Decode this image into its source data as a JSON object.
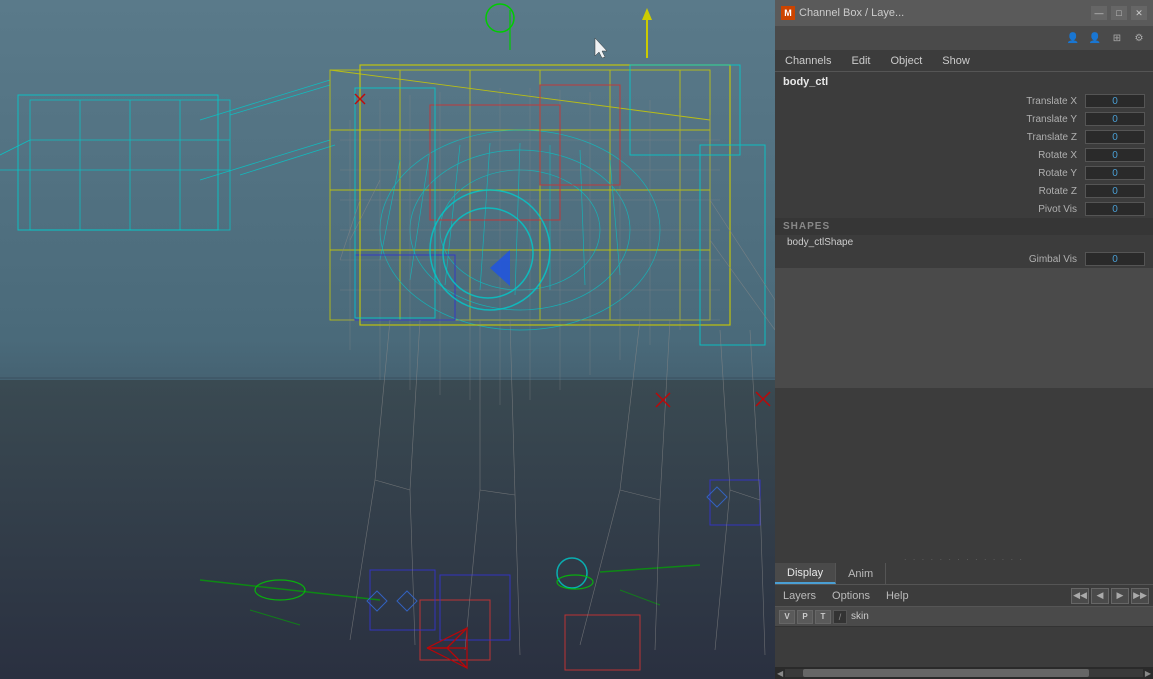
{
  "viewport": {
    "background": "3D viewport with dinosaur skeleton wireframe"
  },
  "channel_box": {
    "title": "Channel Box / Laye...",
    "icon": "M",
    "object_name": "body_ctl",
    "attributes": [
      {
        "name": "Translate X",
        "value": "0"
      },
      {
        "name": "Translate Y",
        "value": "0"
      },
      {
        "name": "Translate Z",
        "value": "0"
      },
      {
        "name": "Rotate X",
        "value": "0"
      },
      {
        "name": "Rotate Y",
        "value": "0"
      },
      {
        "name": "Rotate Z",
        "value": "0"
      },
      {
        "name": "Pivot Vis",
        "value": "0"
      }
    ],
    "shapes_header": "SHAPES",
    "shape_name": "body_ctlShape",
    "shape_attributes": [
      {
        "name": "Gimbal Vis",
        "value": "0"
      }
    ],
    "menu": {
      "channels": "Channels",
      "edit": "Edit",
      "object": "Object",
      "show": "Show"
    }
  },
  "bottom_panel": {
    "tabs": [
      {
        "label": "Display",
        "active": true
      },
      {
        "label": "Anim",
        "active": false
      }
    ],
    "layers_menu": [
      {
        "label": "Layers"
      },
      {
        "label": "Options"
      },
      {
        "label": "Help"
      }
    ],
    "layer_icons": [
      "◀◀",
      "◀",
      "▶",
      "▶▶"
    ],
    "layers": [
      {
        "v_btn": "V",
        "p_btn": "P",
        "t_btn": "T",
        "color_icon": "slash",
        "name": "skin"
      }
    ]
  },
  "title_bar_buttons": {
    "minimize": "—",
    "maximize": "□",
    "close": "✕"
  },
  "toolbar_icons": [
    "person",
    "person2",
    "layout",
    "settings"
  ]
}
